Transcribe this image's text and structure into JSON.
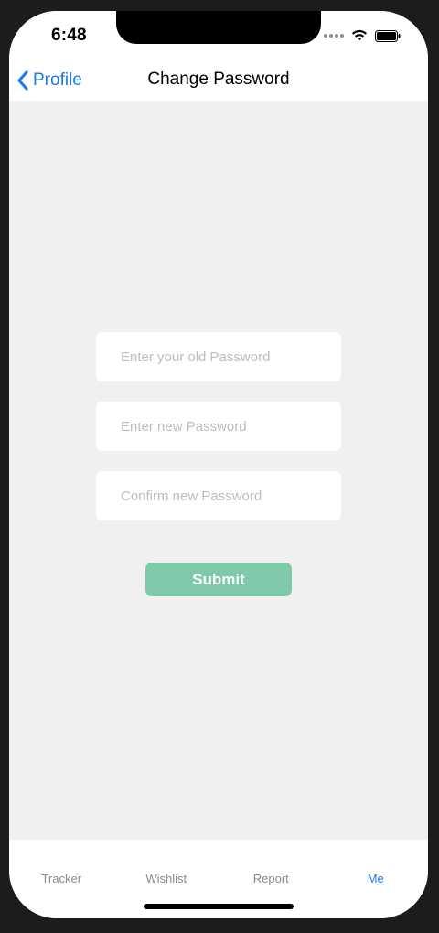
{
  "status_bar": {
    "time": "6:48"
  },
  "nav_bar": {
    "back_label": "Profile",
    "title": "Change Password"
  },
  "form": {
    "old_password_placeholder": "Enter your old Password",
    "new_password_placeholder": "Enter new Password",
    "confirm_password_placeholder": "Confirm new Password",
    "old_password_value": "",
    "new_password_value": "",
    "confirm_password_value": "",
    "submit_label": "Submit"
  },
  "tab_bar": {
    "items": [
      {
        "label": "Tracker",
        "active": false
      },
      {
        "label": "Wishlist",
        "active": false
      },
      {
        "label": "Report",
        "active": false
      },
      {
        "label": "Me",
        "active": true
      }
    ]
  },
  "colors": {
    "accent": "#1a7ae6",
    "submit_bg": "#7dc9aa",
    "background": "#f0f0f0"
  }
}
